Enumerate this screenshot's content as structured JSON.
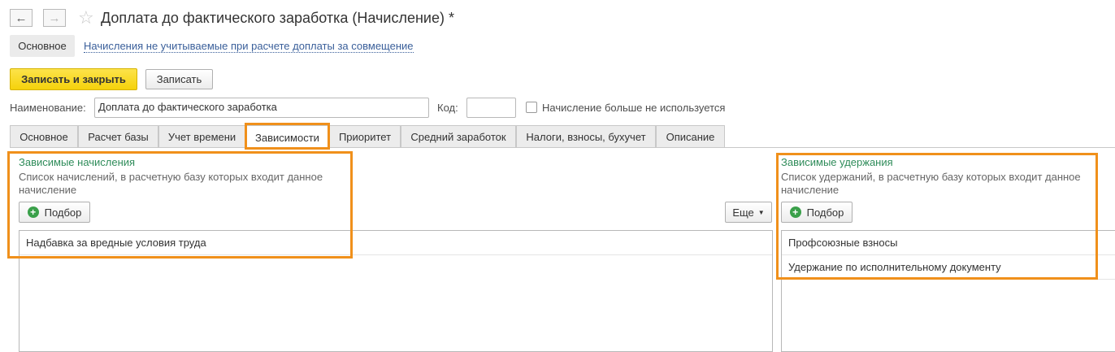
{
  "header": {
    "back_symbol": "←",
    "forward_symbol": "→",
    "star_symbol": "☆",
    "title": "Доплата до фактического заработка (Начисление) *"
  },
  "sections": {
    "main": "Основное",
    "link": "Начисления не учитываемые при расчете доплаты за совмещение"
  },
  "toolbar": {
    "save_close": "Записать и закрыть",
    "save": "Записать"
  },
  "form": {
    "name_label": "Наименование:",
    "name_value": "Доплата до фактического заработка",
    "code_label": "Код:",
    "code_value": "",
    "unused_label": "Начисление больше не используется"
  },
  "tabs": [
    {
      "label": "Основное"
    },
    {
      "label": "Расчет базы"
    },
    {
      "label": "Учет времени"
    },
    {
      "label": "Зависимости"
    },
    {
      "label": "Приоритет"
    },
    {
      "label": "Средний заработок"
    },
    {
      "label": "Налоги, взносы, бухучет"
    },
    {
      "label": "Описание"
    }
  ],
  "active_tab": "Зависимости",
  "left_group": {
    "title": "Зависимые начисления",
    "description": "Список начислений, в расчетную базу которых входит данное начисление",
    "pick_label": "Подбор",
    "more_label": "Еще",
    "rows": [
      "Надбавка за вредные условия труда"
    ]
  },
  "right_group": {
    "title": "Зависимые удержания",
    "description": "Список удержаний, в расчетную базу которых входит данное начисление",
    "pick_label": "Подбор",
    "rows": [
      "Профсоюзные взносы",
      "Удержание по исполнительному документу"
    ]
  },
  "colors": {
    "highlight": "#f0901b",
    "primary_button": "#f5d20b",
    "group_title": "#2f8c5a",
    "link": "#3a5f9a",
    "add_icon": "#3aa04a"
  }
}
